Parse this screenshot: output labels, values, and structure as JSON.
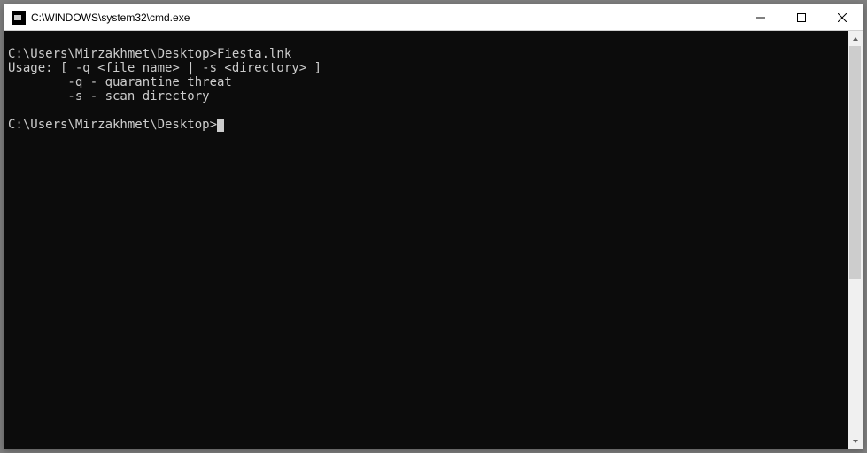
{
  "window": {
    "title": "C:\\WINDOWS\\system32\\cmd.exe"
  },
  "terminal": {
    "lines": [
      "",
      "C:\\Users\\Mirzakhmet\\Desktop>Fiesta.lnk",
      "Usage: [ -q <file name> | -s <directory> ]",
      "        -q - quarantine threat",
      "        -s - scan directory",
      "",
      "C:\\Users\\Mirzakhmet\\Desktop>"
    ]
  }
}
